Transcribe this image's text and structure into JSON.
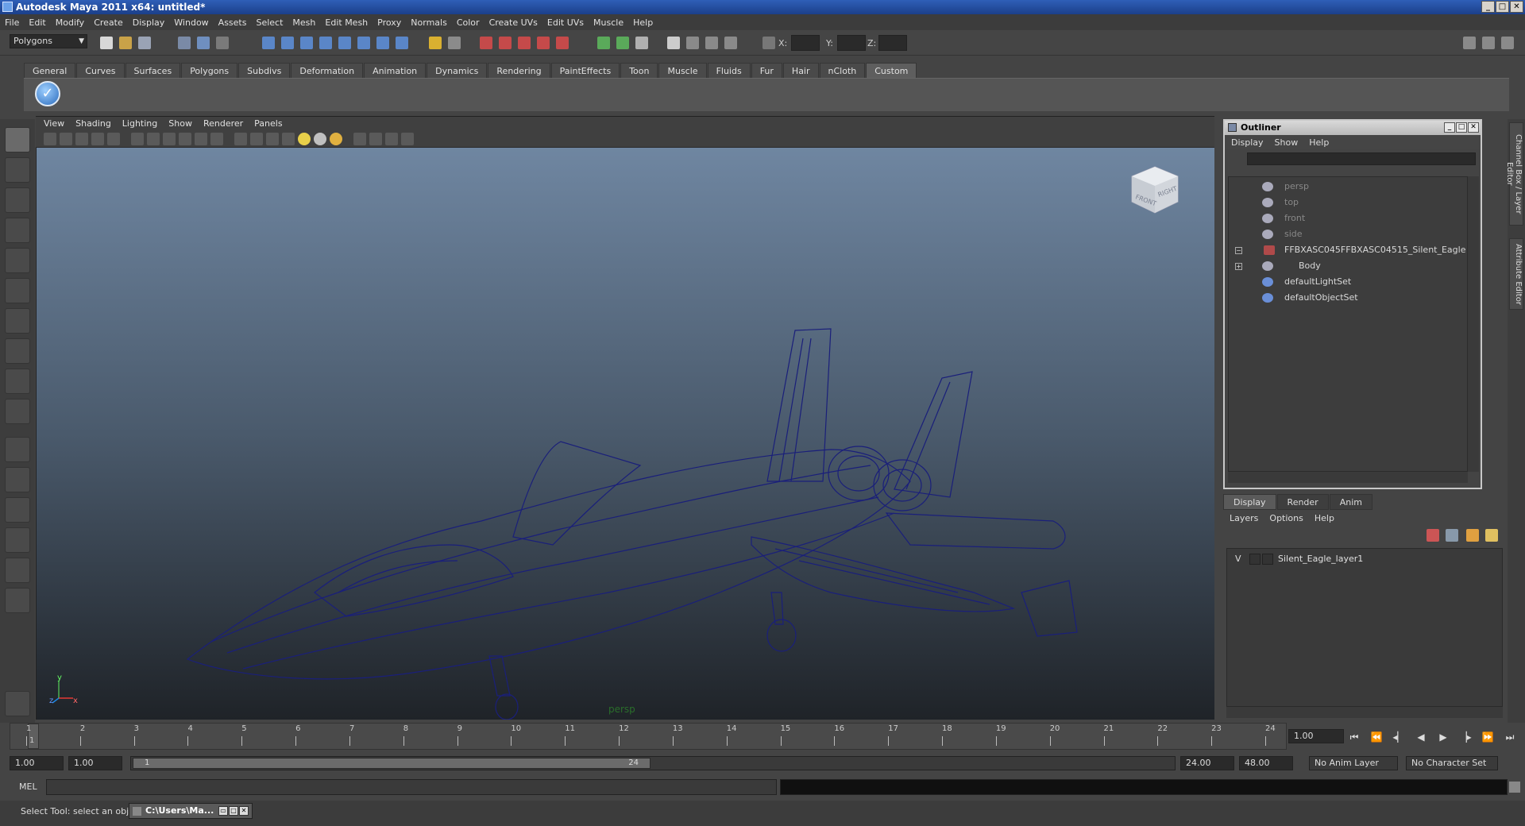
{
  "window": {
    "title": "Autodesk Maya 2011 x64: untitled*"
  },
  "menubar": [
    "File",
    "Edit",
    "Modify",
    "Create",
    "Display",
    "Window",
    "Assets",
    "Select",
    "Mesh",
    "Edit Mesh",
    "Proxy",
    "Normals",
    "Color",
    "Create UVs",
    "Edit UVs",
    "Muscle",
    "Help"
  ],
  "statusline": {
    "mode": "Polygons",
    "x_label": "X:",
    "y_label": "Y:",
    "z_label": "Z:"
  },
  "shelf": {
    "tabs": [
      "General",
      "Curves",
      "Surfaces",
      "Polygons",
      "Subdivs",
      "Deformation",
      "Animation",
      "Dynamics",
      "Rendering",
      "PaintEffects",
      "Toon",
      "Muscle",
      "Fluids",
      "Fur",
      "Hair",
      "nCloth",
      "Custom"
    ],
    "active": "Custom"
  },
  "viewport": {
    "menu": [
      "View",
      "Shading",
      "Lighting",
      "Show",
      "Renderer",
      "Panels"
    ],
    "camera_label": "persp",
    "viewcube_front": "FRONT",
    "viewcube_right": "RIGHT",
    "axis_y": "y",
    "axis_z": "z",
    "axis_x": "x",
    "wire_color": "#1a1f7a"
  },
  "outliner": {
    "title": "Outliner",
    "menu": [
      "Display",
      "Show",
      "Help"
    ],
    "items": [
      {
        "label": "persp",
        "dim": true
      },
      {
        "label": "top",
        "dim": true
      },
      {
        "label": "front",
        "dim": true
      },
      {
        "label": "side",
        "dim": true
      },
      {
        "label": "FFBXASC045FFBXASC04515_Silent_Eagle",
        "dim": false,
        "expander": "−"
      },
      {
        "label": "Body",
        "dim": false,
        "expander": "+"
      },
      {
        "label": "defaultLightSet",
        "dim": false
      },
      {
        "label": "defaultObjectSet",
        "dim": false
      }
    ]
  },
  "right_tabs": [
    "Channel Box / Layer Editor",
    "Attribute Editor"
  ],
  "layer_editor": {
    "tabs": [
      "Display",
      "Render",
      "Anim"
    ],
    "active": "Display",
    "menu": [
      "Layers",
      "Options",
      "Help"
    ],
    "layers": [
      {
        "visible": "V",
        "name": "Silent_Eagle_layer1"
      }
    ]
  },
  "timeslider": {
    "ticks": [
      "1",
      "2",
      "3",
      "4",
      "5",
      "6",
      "7",
      "8",
      "9",
      "10",
      "11",
      "12",
      "13",
      "14",
      "15",
      "16",
      "17",
      "18",
      "19",
      "20",
      "21",
      "22",
      "23",
      "24"
    ],
    "current_marker": "1",
    "current_frame": "1.00"
  },
  "rangeslider": {
    "start_time": "1.00",
    "playback_start": "1.00",
    "range_start_label": "1",
    "range_end_label": "24",
    "playback_end": "24.00",
    "end_time": "48.00",
    "anim_layer": "No Anim Layer",
    "char_set": "No Character Set"
  },
  "commandline": {
    "label": "MEL"
  },
  "helpline": {
    "text": "Select Tool: select an object",
    "taskbar": "C:\\Users\\Ma..."
  }
}
